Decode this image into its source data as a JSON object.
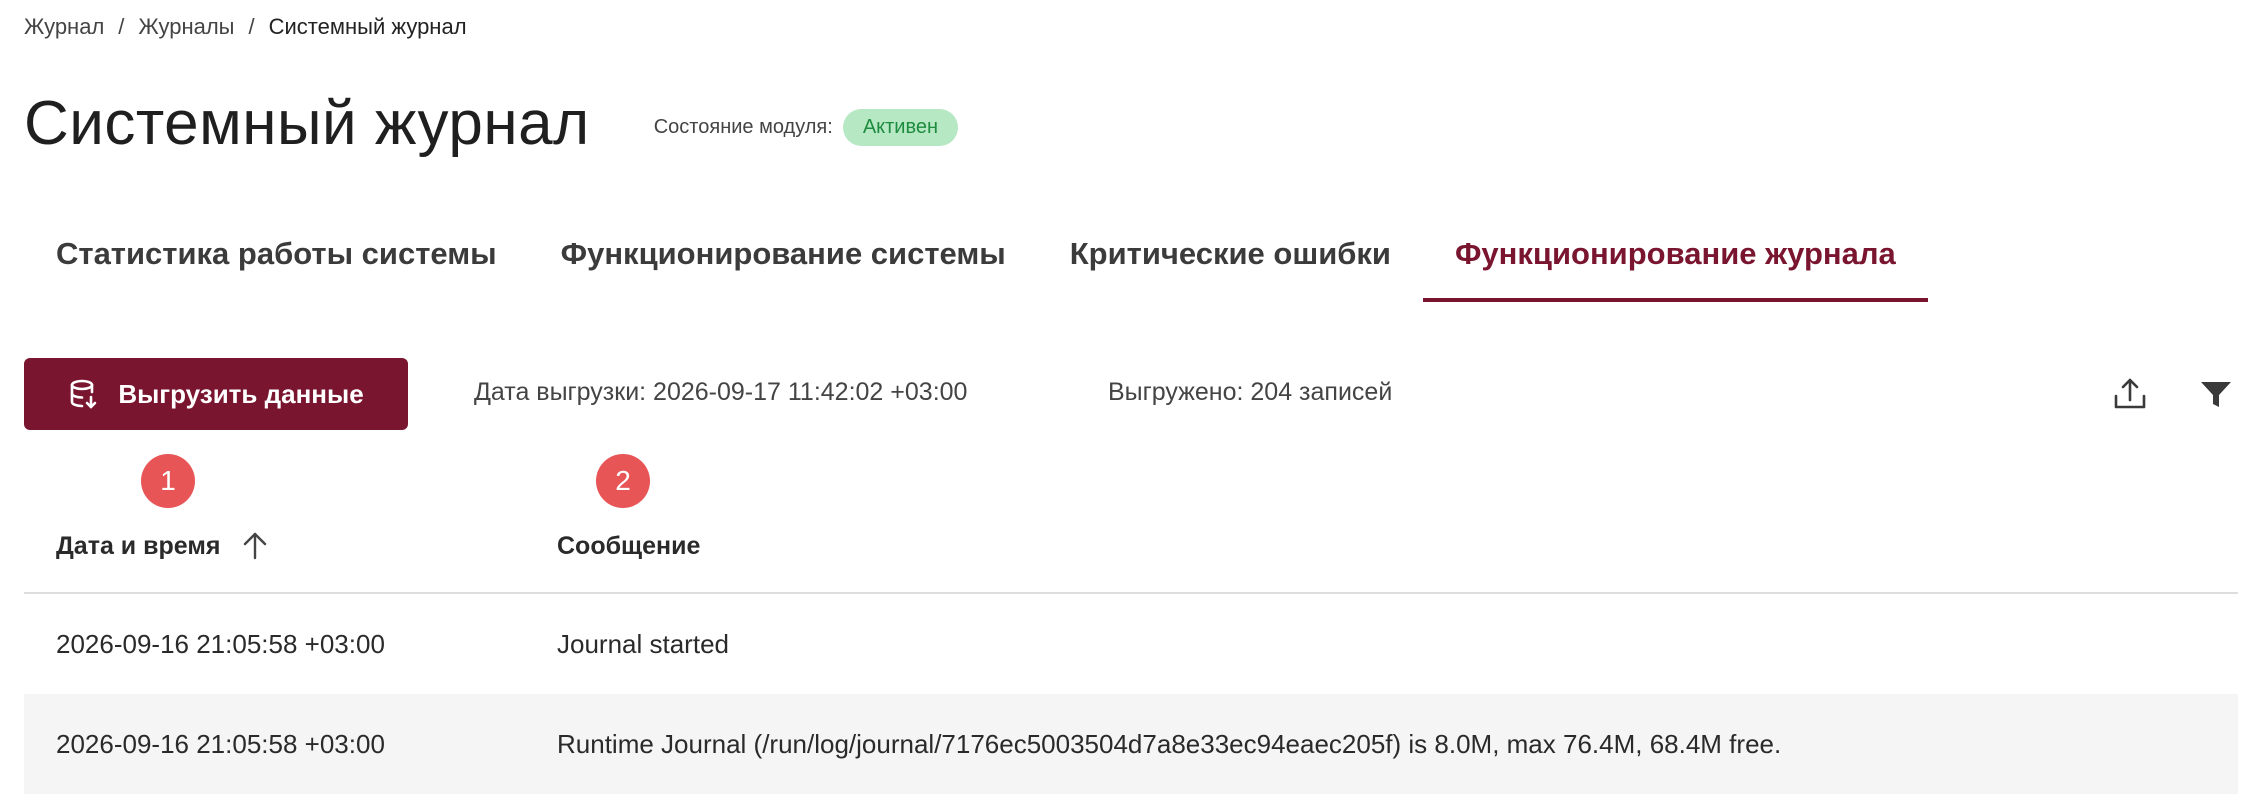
{
  "breadcrumb": {
    "items": [
      "Журнал",
      "Журналы",
      "Системный журнал"
    ],
    "separator": "/"
  },
  "header": {
    "title": "Системный журнал",
    "module_state_label": "Состояние модуля:",
    "module_state_value": "Активен"
  },
  "tabs": [
    {
      "label": "Статистика работы системы",
      "active": false
    },
    {
      "label": "Функционирование системы",
      "active": false
    },
    {
      "label": "Критические ошибки",
      "active": false
    },
    {
      "label": "Функционирование журнала",
      "active": true
    }
  ],
  "toolbar": {
    "export_label": "Выгрузить данные",
    "export_date": "Дата выгрузки: 2026-09-17 11:42:02 +03:00",
    "exported_count": "Выгружено: 204 записей",
    "icons": [
      "upload-icon",
      "filter-icon"
    ]
  },
  "markers": [
    "1",
    "2"
  ],
  "table": {
    "columns": [
      "Дата и время",
      "Сообщение"
    ],
    "sort": {
      "column": "Дата и время",
      "direction": "asc"
    },
    "rows": [
      {
        "datetime": "2026-09-16 21:05:58 +03:00",
        "message": "Journal started"
      },
      {
        "datetime": "2026-09-16 21:05:58 +03:00",
        "message": "Runtime Journal (/run/log/journal/7176ec5003504d7a8e33ec94eaec205f) is 8.0M, max 76.4M, 68.4M free."
      }
    ]
  },
  "colors": {
    "accent": "#7a1530",
    "status_bg": "#b6e8c4",
    "status_text": "#1e8c3f",
    "marker": "#e85556",
    "row_alt": "#f5f5f5"
  }
}
